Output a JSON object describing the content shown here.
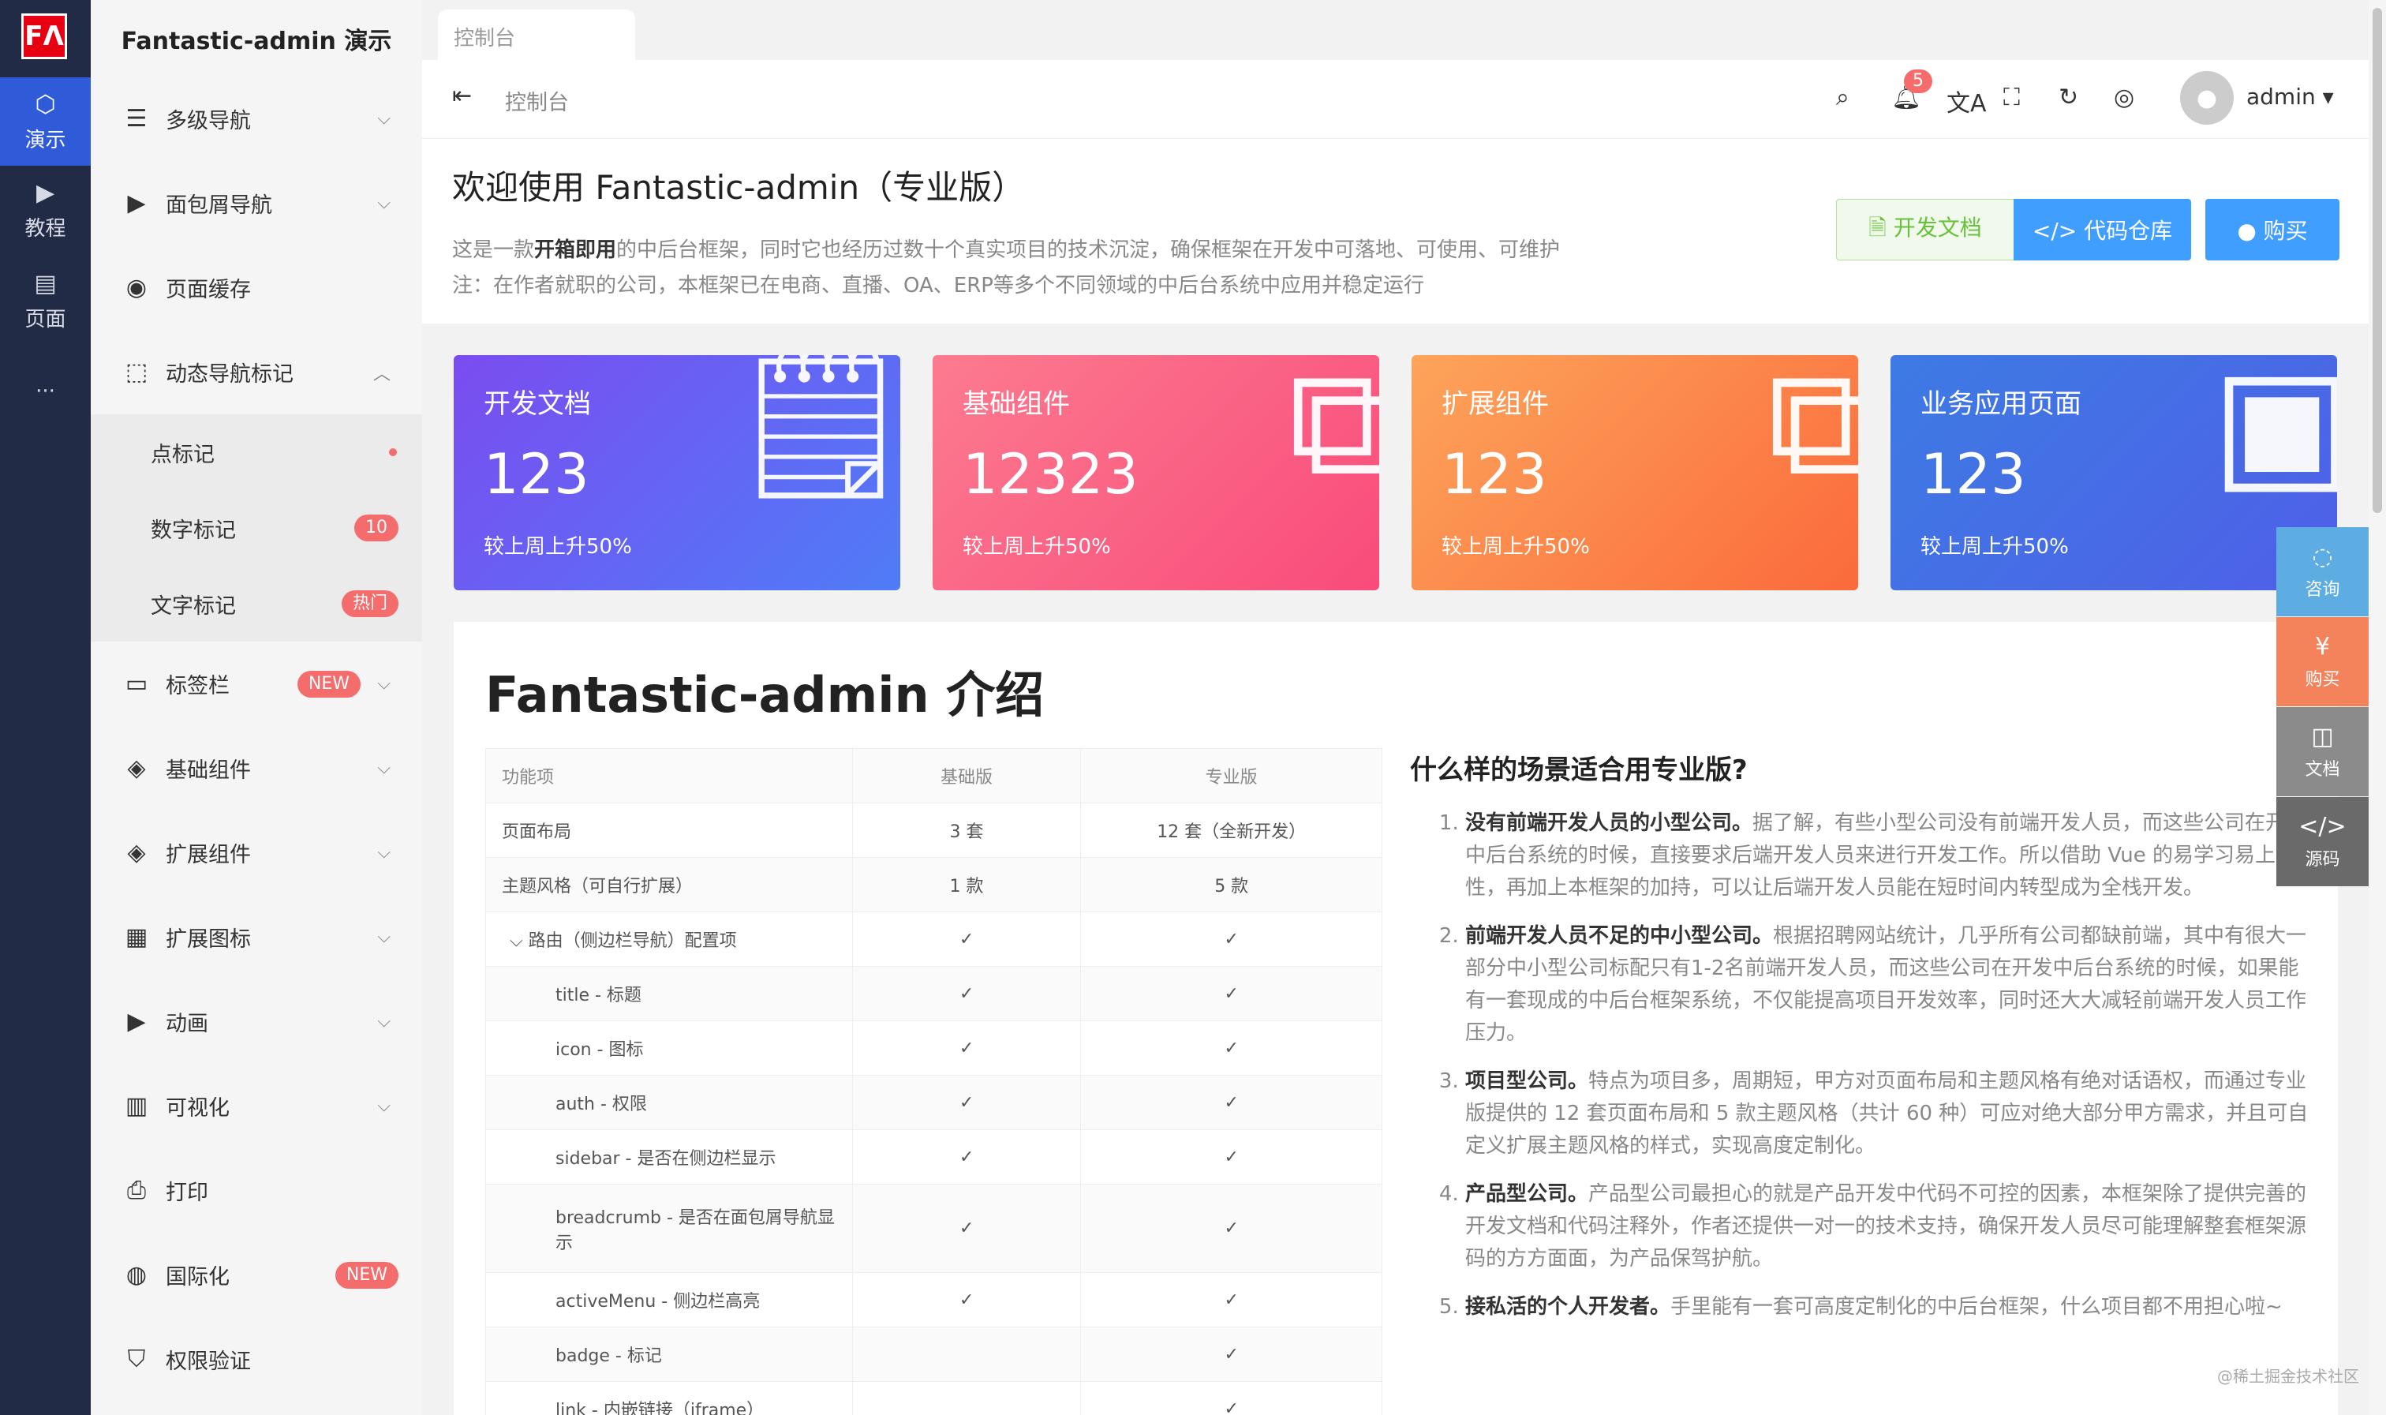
{
  "main_nav": {
    "logo_text": "FΛ",
    "items": [
      {
        "label": "演示",
        "icon": "cube-icon",
        "glyph": "⬡"
      },
      {
        "label": "教程",
        "icon": "play-icon",
        "glyph": "▶"
      },
      {
        "label": "页面",
        "icon": "page-icon",
        "glyph": "▤"
      }
    ],
    "more": "···"
  },
  "sub_nav": {
    "title": "Fantastic-admin 演示",
    "items": [
      {
        "label": "多级导航",
        "icon": "list-icon",
        "glyph": "☰"
      },
      {
        "label": "面包屑导航",
        "icon": "breadcrumb-icon",
        "glyph": "▶"
      },
      {
        "label": "页面缓存",
        "icon": "cache-icon",
        "glyph": "◉"
      },
      {
        "label": "动态导航标记",
        "icon": "mark-icon",
        "glyph": "⬚"
      },
      {
        "label": "点标记"
      },
      {
        "label": "数字标记",
        "badge": "10"
      },
      {
        "label": "文字标记",
        "badge": "热门"
      },
      {
        "label": "标签栏",
        "icon": "tab-icon",
        "glyph": "▭",
        "badge": "NEW"
      },
      {
        "label": "基础组件",
        "icon": "layers-icon",
        "glyph": "◈"
      },
      {
        "label": "扩展组件",
        "icon": "layers-plus-icon",
        "glyph": "◈"
      },
      {
        "label": "扩展图标",
        "icon": "grid-icon",
        "glyph": "▦"
      },
      {
        "label": "动画",
        "icon": "triangle-icon",
        "glyph": "▶"
      },
      {
        "label": "可视化",
        "icon": "bar-chart-icon",
        "glyph": "▥"
      },
      {
        "label": "打印",
        "icon": "printer-icon",
        "glyph": "⎙"
      },
      {
        "label": "国际化",
        "icon": "globe-icon",
        "glyph": "◍",
        "badge": "NEW"
      },
      {
        "label": "权限验证",
        "icon": "shield-icon",
        "glyph": "⛉"
      }
    ]
  },
  "topbar": {
    "tab": "控制台",
    "breadcrumb": "控制台",
    "bell_count": "5",
    "user": "admin ▾"
  },
  "welcome": {
    "title": "欢迎使用 Fantastic-admin（专业版）",
    "desc_pre": "这是一款",
    "desc_bold": "开箱即用",
    "desc_post": "的中后台框架，同时它也经历过数十个真实项目的技术沉淀，确保框架在开发中可落地、可使用、可维护",
    "note": "注：在作者就职的公司，本框架已在电商、直播、OA、ERP等多个不同领域的中后台系统中应用并稳定运行",
    "btn_doc": "🗎 开发文档",
    "btn_repo": "</> 代码仓库",
    "btn_buy": "● 购买"
  },
  "cards": [
    {
      "title": "开发文档",
      "value": "123",
      "sub": "较上周上升50%",
      "icon": "document-icon",
      "glyph": "🗒"
    },
    {
      "title": "基础组件",
      "value": "12323",
      "sub": "较上周上升50%",
      "icon": "puzzle-icon",
      "glyph": "⧉"
    },
    {
      "title": "扩展组件",
      "value": "123",
      "sub": "较上周上升50%",
      "icon": "puzzle-icon",
      "glyph": "⧉"
    },
    {
      "title": "业务应用页面",
      "value": "123",
      "sub": "较上周上升50%",
      "icon": "window-icon",
      "glyph": "▣"
    }
  ],
  "intro": {
    "title": "Fantastic-admin 介绍",
    "table": {
      "headers": [
        "功能项",
        "基础版",
        "专业版"
      ],
      "rows": [
        [
          "页面布局",
          "3 套",
          "12 套（全新开发）"
        ],
        [
          "主题风格（可自行扩展）",
          "1 款",
          "5 款"
        ],
        [
          "⌵ 路由（侧边栏导航）配置项",
          "✓",
          "✓"
        ],
        [
          "title - 标题",
          "✓",
          "✓"
        ],
        [
          "icon - 图标",
          "✓",
          "✓"
        ],
        [
          "auth - 权限",
          "✓",
          "✓"
        ],
        [
          "sidebar - 是否在侧边栏显示",
          "✓",
          "✓"
        ],
        [
          "breadcrumb - 是否在面包屑导航显示",
          "✓",
          "✓"
        ],
        [
          "activeMenu - 侧边栏高亮",
          "✓",
          "✓"
        ],
        [
          "badge - 标记",
          "",
          "✓"
        ],
        [
          "link - 内嵌链接（iframe）",
          "",
          "✓"
        ]
      ]
    },
    "scene_title": "什么样的场景适合用专业版?",
    "scenes": [
      {
        "bold": "没有前端开发人员的小型公司。",
        "text": "据了解，有些小型公司没有前端开发人员，而这些公司在开发中后台系统的时候，直接要求后端开发人员来进行开发工作。所以借助 Vue 的易学习易上手特性，再加上本框架的加持，可以让后端开发人员能在短时间内转型成为全栈开发。"
      },
      {
        "bold": "前端开发人员不足的中小型公司。",
        "text": "根据招聘网站统计，几乎所有公司都缺前端，其中有很大一部分中小型公司标配只有1-2名前端开发人员，而这些公司在开发中后台系统的时候，如果能有一套现成的中后台框架系统，不仅能提高项目开发效率，同时还大大减轻前端开发人员工作压力。"
      },
      {
        "bold": "项目型公司。",
        "text": "特点为项目多，周期短，甲方对页面布局和主题风格有绝对话语权，而通过专业版提供的 12 套页面布局和 5 款主题风格（共计 60 种）可应对绝大部分甲方需求，并且可自定义扩展主题风格的样式，实现高度定制化。"
      },
      {
        "bold": "产品型公司。",
        "text": "产品型公司最担心的就是产品开发中代码不可控的因素，本框架除了提供完善的开发文档和代码注释外，作者还提供一对一的技术支持，确保开发人员尽可能理解整套框架源码的方方面面，为产品保驾护航。"
      },
      {
        "bold": "接私活的个人开发者。",
        "text": "手里能有一套可高度定制化的中后台框架，什么项目都不用担心啦~"
      }
    ]
  },
  "float_buttons": [
    {
      "label": "咨询",
      "icon": "chat-icon",
      "glyph": "◌"
    },
    {
      "label": "购买",
      "icon": "yen-icon",
      "glyph": "¥"
    },
    {
      "label": "文档",
      "icon": "book-icon",
      "glyph": "◫"
    },
    {
      "label": "源码",
      "icon": "code-icon",
      "glyph": "</>"
    }
  ],
  "watermark": "@稀土掘金技术社区"
}
